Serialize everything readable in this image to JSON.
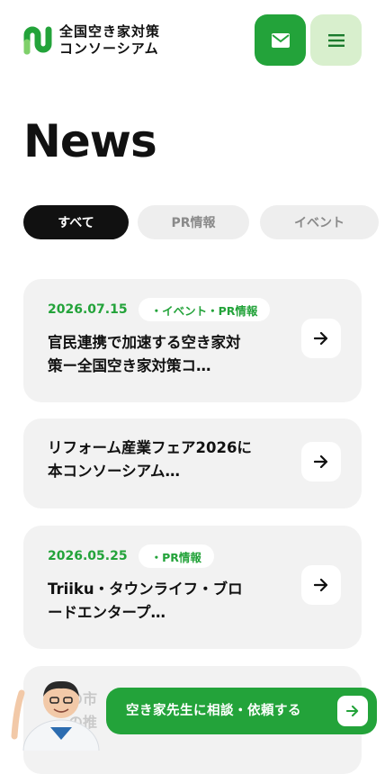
{
  "header": {
    "logo_line1": "全国空き家対策",
    "logo_line2": "コンソーシアム",
    "mail_icon": "mail-icon",
    "menu_icon": "hamburger-menu-icon"
  },
  "page_title": "News",
  "tabs": [
    {
      "label": "すべて",
      "active": true
    },
    {
      "label": "PR情報",
      "active": false
    },
    {
      "label": "イベント",
      "active": false
    }
  ],
  "news": [
    {
      "date": "2026.07.15",
      "tag": "・イベント・PR情報",
      "title_line1": "官民連携で加速する空き家対",
      "title_line2": "策ー全国空き家対策コ…"
    },
    {
      "date": "",
      "tag": "",
      "title_line1": "リフォーム産業フェア2026に",
      "title_line2": "本コンソーシアム…"
    },
    {
      "date": "2026.05.25",
      "tag": "・PR情報",
      "title_line1": "Triiku・タウンライフ・ブロ",
      "title_line2": "ードエンタープ…"
    }
  ],
  "faded_card": {
    "line1": "…の市",
    "line2": "…の推"
  },
  "cta": {
    "label": "空き家先生に相談・依頼する"
  },
  "colors": {
    "brand_green": "#23a33a",
    "light_green": "#d8efcd",
    "card_bg": "#f2f2f2"
  }
}
